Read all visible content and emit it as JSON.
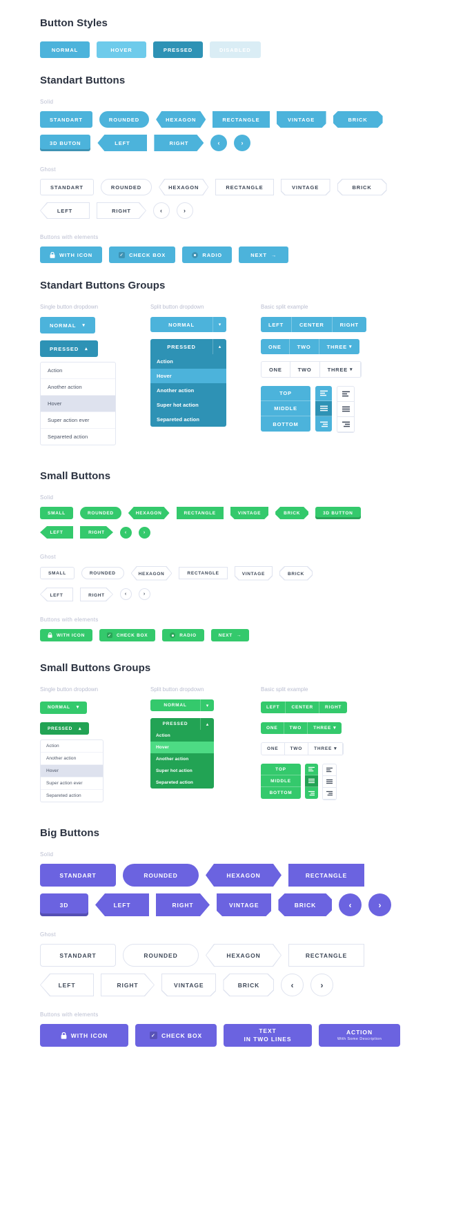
{
  "sections": {
    "button_styles": {
      "title": "Button Styles",
      "buttons": [
        {
          "label": "NORMAL",
          "state": "normal"
        },
        {
          "label": "HOVER",
          "state": "hover"
        },
        {
          "label": "PRESSED",
          "state": "pressed"
        },
        {
          "label": "DISABLED",
          "state": "disabled"
        }
      ]
    },
    "standart_buttons": {
      "title": "Standart Buttons",
      "labels": {
        "solid": "Solid",
        "ghost": "Ghost",
        "elements": "Buttons with elements"
      },
      "solid_row1": [
        "STANDART",
        "ROUNDED",
        "HEXAGON",
        "RECTANGLE",
        "VINTAGE",
        "BRICK"
      ],
      "solid_row2": [
        "3D BUTON",
        "LEFT",
        "RIGHT"
      ],
      "ghost_row1": [
        "STANDART",
        "ROUNDED",
        "HEXAGON",
        "RECTANGLE",
        "VINTAGE",
        "BRICK"
      ],
      "ghost_row2": [
        "LEFT",
        "RIGHT"
      ],
      "elements": [
        "WITH ICON",
        "CHECK BOX",
        "RADIO",
        "NEXT"
      ]
    },
    "standart_groups": {
      "title": "Standart Buttons Groups",
      "col1_head": "Single button dropdown",
      "col2_head": "Split button dropdown",
      "col3_head": "Basic split example",
      "single_normal": "NORMAL",
      "single_pressed": "PRESSED",
      "menu_items": [
        "Action",
        "Another action",
        "Hover",
        "Super action ever",
        "Separeted action"
      ],
      "split_normal": "NORMAL",
      "split_pressed": "PRESSED",
      "split_items": [
        "Action",
        "Hover",
        "Another action",
        "Super hot action",
        "Separeted action"
      ],
      "seg_lcr": [
        "LEFT",
        "CENTER",
        "RIGHT"
      ],
      "seg_123_solid": [
        "ONE",
        "TWO",
        "THREE"
      ],
      "seg_123_ghost": [
        "ONE",
        "TWO",
        "THREE"
      ],
      "seg_vertical": [
        "TOP",
        "MIDDLE",
        "BOTTOM"
      ]
    },
    "small_buttons": {
      "title": "Small Buttons",
      "labels": {
        "solid": "Solid",
        "ghost": "Ghost",
        "elements": "Buttons with elements"
      },
      "solid_row1": [
        "SMALL",
        "ROUNDED",
        "HEXAGON",
        "RECTANGLE",
        "VINTAGE",
        "BRICK",
        "3D BUTTON"
      ],
      "solid_row2": [
        "LEFT",
        "RIGHT"
      ],
      "ghost_row1": [
        "SMALL",
        "ROUNDED",
        "HEXAGON",
        "RECTANGLE",
        "VINTAGE",
        "BRICK"
      ],
      "ghost_row2": [
        "LEFT",
        "RIGHT"
      ],
      "elements": [
        "WITH ICON",
        "CHECK BOX",
        "RADIO",
        "NEXT"
      ]
    },
    "small_groups": {
      "title": "Small Buttons Groups",
      "col1_head": "Single button dropdown",
      "col2_head": "Split button dropdown",
      "col3_head": "Basic split example",
      "single_normal": "NORMAL",
      "single_pressed": "PRESSED",
      "menu_items": [
        "Action",
        "Another action",
        "Hover",
        "Super action ever",
        "Separeted action"
      ],
      "split_normal": "NORMAL",
      "split_pressed": "PRESSED",
      "split_items": [
        "Action",
        "Hover",
        "Another action",
        "Super hot action",
        "Separeted action"
      ],
      "seg_lcr": [
        "LEFT",
        "CENTER",
        "RIGHT"
      ],
      "seg_123_solid": [
        "ONE",
        "TWO",
        "THREE"
      ],
      "seg_123_ghost": [
        "ONE",
        "TWO",
        "THREE"
      ],
      "seg_vertical": [
        "TOP",
        "MIDDLE",
        "BOTTOM"
      ]
    },
    "big_buttons": {
      "title": "Big Buttons",
      "labels": {
        "solid": "Solid",
        "ghost": "Ghost",
        "elements": "Buttons with elements"
      },
      "solid_row1": [
        "STANDART",
        "ROUNDED",
        "HEXAGON",
        "RECTANGLE"
      ],
      "solid_row2": [
        "3D",
        "LEFT",
        "RIGHT",
        "VINTAGE",
        "BRICK"
      ],
      "ghost_row1": [
        "STANDART",
        "ROUNDED",
        "HEXAGON",
        "RECTANGLE"
      ],
      "ghost_row2": [
        "LEFT",
        "RIGHT",
        "VINTAGE",
        "BRICK"
      ],
      "elements": [
        {
          "label": "WITH ICON",
          "icon": "lock-icon"
        },
        {
          "label": "CHECK BOX",
          "icon": "checkbox-icon"
        },
        {
          "line1": "TEXT",
          "line2": "IN TWO LINES"
        },
        {
          "line1": "ACTION",
          "line2": "With Some Description"
        }
      ]
    }
  },
  "icons": {
    "chevron_left": "‹",
    "chevron_right": "›",
    "caret_down": "⌄",
    "caret_up": "⌃",
    "arrow_right": "→",
    "check": "✓"
  },
  "colors": {
    "blue": "#4cb3db",
    "blue_hover": "#6ecbeb",
    "blue_pressed": "#2e92b5",
    "blue_disabled": "#daedf5",
    "green": "#34c96c",
    "green_dark": "#22a354",
    "purple": "#6b63e0",
    "ghost_border": "#dfe3ef",
    "text": "#3d4757",
    "muted": "#b9bdd0"
  }
}
